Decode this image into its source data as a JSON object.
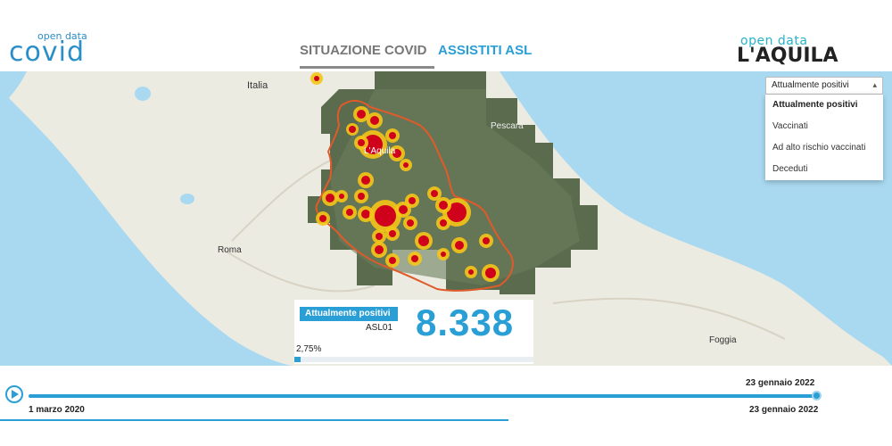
{
  "header": {
    "logo_left_small": "open data",
    "logo_left_big": "covid",
    "tabs": [
      {
        "label": "SITUAZIONE COVID",
        "active": true
      },
      {
        "label": "ASSISTITI ASL",
        "active": false
      }
    ],
    "logo_right_small": "open data",
    "logo_right_big": "L'AQUILA"
  },
  "map": {
    "labels": {
      "italia": "Italia",
      "roma": "Roma",
      "laquila": "L'Aquila",
      "pescara": "Pescara",
      "foggia": "Foggia"
    },
    "select": {
      "value": "Attualmente positivi",
      "options": [
        "Attualmente positivi",
        "Vaccinati",
        "Ad alto rischio vaccinati",
        "Deceduti"
      ]
    },
    "colors": {
      "sea": "#a9d9f0",
      "land": "#ecebe1",
      "satellite": "#5a6b4e",
      "border": "#e05a2a",
      "heat_core": "#d0021b",
      "heat_edge": "#f5c518"
    }
  },
  "card": {
    "badge": "Attualmente positivi",
    "asl": "ASL01",
    "value": "8.338",
    "percent": "2,75%",
    "percent_value": 0.0275
  },
  "timeline": {
    "current_date": "23 gennaio 2022",
    "start_date": "1 marzo 2020",
    "end_date": "23 gennaio 2022",
    "progress": 1.0
  }
}
